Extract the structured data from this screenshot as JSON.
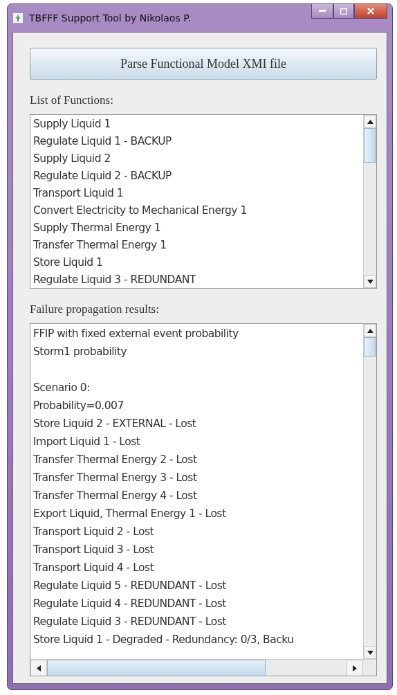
{
  "window": {
    "title": "TBFFF Support Tool by Nikolaos P."
  },
  "parse_button": {
    "label": "Parse Functional Model XMI file"
  },
  "functions_label": "List of Functions:",
  "functions": [
    "Supply Liquid 1",
    "Regulate Liquid 1 - BACKUP",
    "Supply Liquid 2",
    "Regulate Liquid 2 - BACKUP",
    "Transport Liquid 1",
    "Convert Electricity to Mechanical Energy 1",
    "Supply Thermal Energy 1",
    "Transfer Thermal Energy 1",
    "Store Liquid 1",
    "Regulate Liquid 3 - REDUNDANT"
  ],
  "results_label": "Failure propagation results:",
  "result_blocks": [
    [
      "FFIP with fixed external event probability",
      "Storm1 probability"
    ],
    [
      "Scenario 0:",
      "Probability=0.007",
      "Store Liquid 2 - EXTERNAL - Lost",
      "Import Liquid 1 - Lost",
      "Transfer Thermal Energy 2 - Lost",
      "Transfer Thermal Energy 3 - Lost",
      "Transfer Thermal Energy 4 - Lost",
      "Export Liquid, Thermal Energy 1 - Lost",
      "Transport Liquid 2 - Lost",
      "Transport Liquid 3 - Lost",
      "Transport Liquid 4 - Lost",
      "Regulate Liquid 5 - REDUNDANT - Lost",
      "Regulate Liquid 4 - REDUNDANT - Lost",
      "Regulate Liquid 3 - REDUNDANT - Lost",
      "Store Liquid 1 - Degraded - Redundancy: 0/3, Backu"
    ]
  ]
}
